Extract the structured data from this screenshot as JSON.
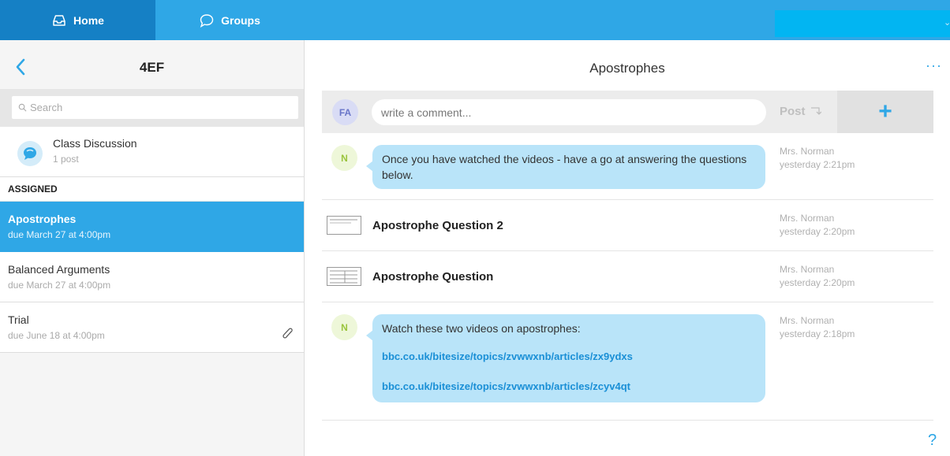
{
  "nav": {
    "home_label": "Home",
    "groups_label": "Groups"
  },
  "sidebar": {
    "title": "4EF",
    "search_placeholder": "Search",
    "class_discussion": {
      "title": "Class Discussion",
      "subtitle": "1 post"
    },
    "assigned_header": "ASSIGNED",
    "items": [
      {
        "title": "Apostrophes",
        "due": "due March 27 at 4:00pm",
        "active": true
      },
      {
        "title": "Balanced Arguments",
        "due": "due March 27 at 4:00pm",
        "active": false
      },
      {
        "title": "Trial",
        "due": "due June 18 at 4:00pm",
        "active": false
      }
    ]
  },
  "main": {
    "title": "Apostrophes",
    "comment": {
      "avatar": "FA",
      "placeholder": "write a comment...",
      "post_label": "Post",
      "add_icon": "+"
    },
    "feed": [
      {
        "type": "message",
        "avatar": "N",
        "text": "Once you have watched the videos - have a go at answering the questions below.",
        "author": "Mrs. Norman",
        "time": "yesterday 2:21pm"
      },
      {
        "type": "file",
        "title": "Apostrophe Question 2",
        "author": "Mrs. Norman",
        "time": "yesterday 2:20pm"
      },
      {
        "type": "file",
        "title": "Apostrophe Question",
        "author": "Mrs. Norman",
        "time": "yesterday 2:20pm"
      },
      {
        "type": "message",
        "avatar": "N",
        "text": "Watch these two videos on apostrophes:",
        "links": [
          "bbc.co.uk/bitesize/topics/zvwwxnb/articles/zx9ydxs",
          "bbc.co.uk/bitesize/topics/zvwwxnb/articles/zcyv4qt"
        ],
        "author": "Mrs. Norman",
        "time": "yesterday 2:18pm"
      }
    ],
    "more_icon": "···",
    "help_icon": "?"
  },
  "colors": {
    "brand": "#2fa7e6",
    "brand_dark": "#1580c5",
    "bubble": "#b9e4f9"
  }
}
